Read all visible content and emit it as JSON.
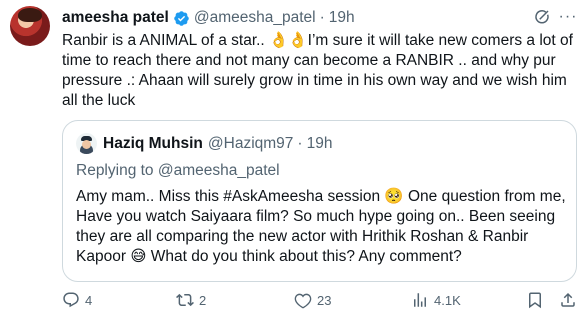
{
  "post": {
    "author_name": "ameesha patel",
    "author_handle": "@ameesha_patel",
    "separator": "·",
    "time": "19h",
    "text_lines": [
      "Ranbir is a ANIMAL of a star.. 👌👌I’m sure it will take new comers a lot of",
      "time to reach there and not many can become  a  RANBIR .. and why pur",
      "pressure .: Ahaan will surely grow in time in his own way and we wish him",
      "all the luck"
    ]
  },
  "quote": {
    "author_name": "Haziq Muhsin",
    "author_handle": "@Haziqm97",
    "separator": "·",
    "time": "19h",
    "replying_prefix": "Replying to ",
    "replying_to": "@ameesha_patel",
    "text_lines": [
      "Amy mam.. Miss this #AskAmeesha session 🥺 One question from me,",
      "Have you watch Saiyaara film? So much hype going on.. Been seeing",
      "they are all comparing the new actor with Hrithik Roshan & Ranbir",
      "Kapoor 😅 What do you think about this? Any comment?"
    ]
  },
  "actions": {
    "replies": "4",
    "reposts": "2",
    "likes": "23",
    "views": "4.1K"
  },
  "icons": {
    "verified": "verified-badge-icon",
    "grok": "grok-icon",
    "more": "more-icon",
    "reply": "reply-icon",
    "repost": "repost-icon",
    "like": "like-icon",
    "views": "views-icon",
    "bookmark": "bookmark-icon"
  },
  "colors": {
    "text": "#0f1419",
    "secondary": "#536471",
    "verified": "#1d9bf0",
    "border": "#cfd9de"
  }
}
